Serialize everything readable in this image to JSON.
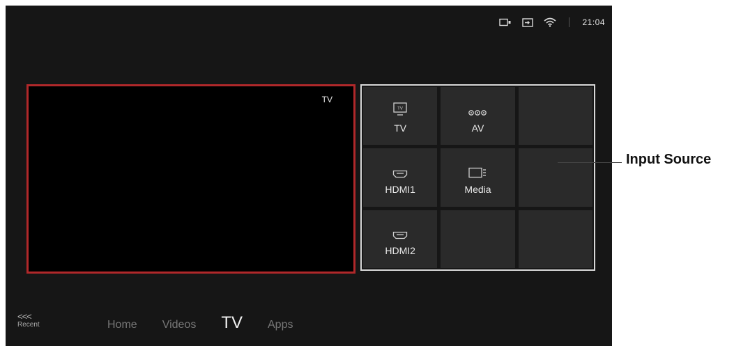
{
  "status_bar": {
    "icons": [
      "camera-icon",
      "input-icon",
      "wifi-icon"
    ],
    "time": "21:04"
  },
  "preview": {
    "label": "TV"
  },
  "input_grid": {
    "tiles": [
      {
        "label": "TV",
        "icon": "tv-icon"
      },
      {
        "label": "AV",
        "icon": "av-icon"
      },
      {
        "label": "",
        "icon": ""
      },
      {
        "label": "HDMI1",
        "icon": "hdmi-icon"
      },
      {
        "label": "Media",
        "icon": "media-icon"
      },
      {
        "label": "",
        "icon": ""
      },
      {
        "label": "HDMI2",
        "icon": "hdmi-icon"
      },
      {
        "label": "",
        "icon": ""
      },
      {
        "label": "",
        "icon": ""
      }
    ]
  },
  "nav": {
    "recent_arrows": "<<<",
    "recent_label": "Recent",
    "items": [
      "Home",
      "Videos",
      "TV",
      "Apps"
    ],
    "active": "TV"
  },
  "callout": {
    "text": "Input Source"
  },
  "colors": {
    "screen_bg": "#161616",
    "preview_border": "#b0282a",
    "grid_border": "#d8d8d8",
    "tile_bg": "#2a2a2a"
  }
}
